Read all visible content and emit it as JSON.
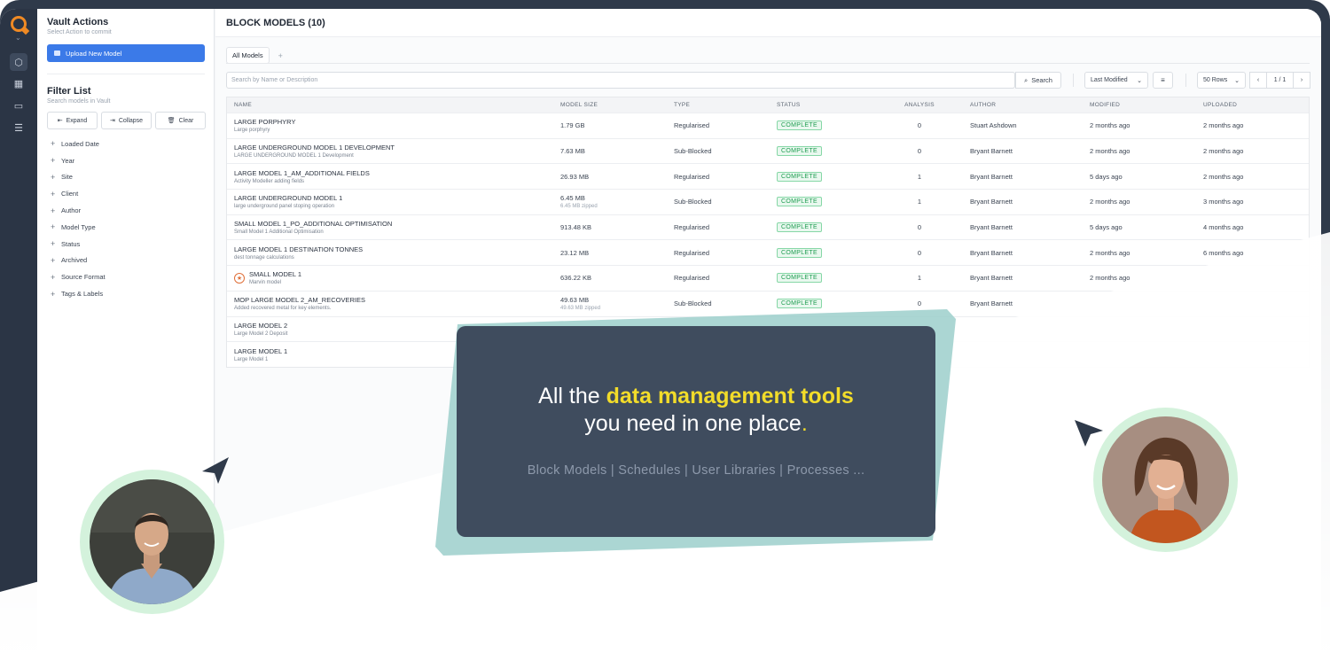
{
  "sidebar": {
    "vault_actions": {
      "title": "Vault Actions",
      "subtitle": "Select Action to commit",
      "upload_label": "Upload New Model"
    },
    "filter": {
      "title": "Filter List",
      "subtitle": "Search models in Vault",
      "expand_label": "Expand",
      "collapse_label": "Collapse",
      "clear_label": "Clear",
      "items": [
        "Loaded Date",
        "Year",
        "Site",
        "Client",
        "Author",
        "Model Type",
        "Status",
        "Archived",
        "Source Format",
        "Tags & Labels"
      ]
    }
  },
  "header": {
    "title": "BLOCK MODELS (10)"
  },
  "tabs": [
    {
      "label": "All Models"
    }
  ],
  "tab_add": "+",
  "toolbar": {
    "search_placeholder": "Search by Name or Description",
    "search_button": "Search",
    "sort_value": "Last Modified",
    "rows_value": "50 Rows",
    "page": "1 / 1"
  },
  "table": {
    "columns": [
      "NAME",
      "MODEL SIZE",
      "TYPE",
      "STATUS",
      "ANALYSIS",
      "AUTHOR",
      "MODIFIED",
      "UPLOADED"
    ],
    "rows": [
      {
        "name": "LARGE PORPHYRY",
        "desc": "Large porphyry",
        "size": "1.79 GB",
        "zip": "",
        "type": "Regularised",
        "status": "COMPLETE",
        "analysis": "0",
        "author": "Stuart Ashdown",
        "modified": "2 months ago",
        "uploaded": "2 months ago",
        "starred": false
      },
      {
        "name": "LARGE UNDERGROUND MODEL 1 DEVELOPMENT",
        "desc": "LARGE UNDERGROUND MODEL 1 Development",
        "size": "7.63 MB",
        "zip": "",
        "type": "Sub-Blocked",
        "status": "COMPLETE",
        "analysis": "0",
        "author": "Bryant Barnett",
        "modified": "2 months ago",
        "uploaded": "2 months ago",
        "starred": false
      },
      {
        "name": "LARGE MODEL 1_AM_ADDITIONAL FIELDS",
        "desc": "Activity Modeller adding fields",
        "size": "26.93 MB",
        "zip": "",
        "type": "Regularised",
        "status": "COMPLETE",
        "analysis": "1",
        "author": "Bryant Barnett",
        "modified": "5 days ago",
        "uploaded": "2 months ago",
        "starred": false
      },
      {
        "name": "LARGE UNDERGROUND MODEL 1",
        "desc": "large underground panel stoping operation",
        "size": "6.45 MB",
        "zip": "6.45 MB zipped",
        "type": "Sub-Blocked",
        "status": "COMPLETE",
        "analysis": "1",
        "author": "Bryant Barnett",
        "modified": "2 months ago",
        "uploaded": "3 months ago",
        "starred": false
      },
      {
        "name": "SMALL MODEL 1_PO_ADDITIONAL OPTIMISATION",
        "desc": "Small Model 1 Additional Optimisation",
        "size": "913.48 KB",
        "zip": "",
        "type": "Regularised",
        "status": "COMPLETE",
        "analysis": "0",
        "author": "Bryant Barnett",
        "modified": "5 days ago",
        "uploaded": "4 months ago",
        "starred": false
      },
      {
        "name": "LARGE MODEL 1 DESTINATION TONNES",
        "desc": "dest tonnage calculations",
        "size": "23.12 MB",
        "zip": "",
        "type": "Regularised",
        "status": "COMPLETE",
        "analysis": "0",
        "author": "Bryant Barnett",
        "modified": "2 months ago",
        "uploaded": "6 months ago",
        "starred": false
      },
      {
        "name": "SMALL MODEL 1",
        "desc": "Marvin model",
        "size": "636.22 KB",
        "zip": "",
        "type": "Regularised",
        "status": "COMPLETE",
        "analysis": "1",
        "author": "Bryant Barnett",
        "modified": "2 months ago",
        "uploaded": "",
        "starred": true
      },
      {
        "name": "MOP LARGE MODEL 2_AM_RECOVERIES",
        "desc": "Added recovered metal for key elements.",
        "size": "49.63 MB",
        "zip": "49.63 MB zipped",
        "type": "Sub-Blocked",
        "status": "COMPLETE",
        "analysis": "0",
        "author": "Bryant Barnett",
        "modified": "",
        "uploaded": "",
        "starred": false
      },
      {
        "name": "LARGE MODEL 2",
        "desc": "Large Model 2 Deposit",
        "size": "",
        "zip": "",
        "type": "",
        "status": "",
        "analysis": "",
        "author": "",
        "modified": "",
        "uploaded": "",
        "starred": false
      },
      {
        "name": "LARGE MODEL 1",
        "desc": "Large Model 1",
        "size": "",
        "zip": "",
        "type": "",
        "status": "",
        "analysis": "",
        "author": "",
        "modified": "",
        "uploaded": "",
        "starred": false
      }
    ]
  },
  "hero": {
    "line1_pre": "All the ",
    "line1_highlight": "data management tools",
    "line2": "you need in one place",
    "line2_dot": ".",
    "tagline": "Block Models | Schedules | User Libraries | Processes ..."
  },
  "colors": {
    "accent": "#3b7ae8",
    "highlight": "#f2dc2a",
    "card": "#3f4c5e",
    "teal": "#9ccfcb",
    "complete": "#1e9d50"
  }
}
